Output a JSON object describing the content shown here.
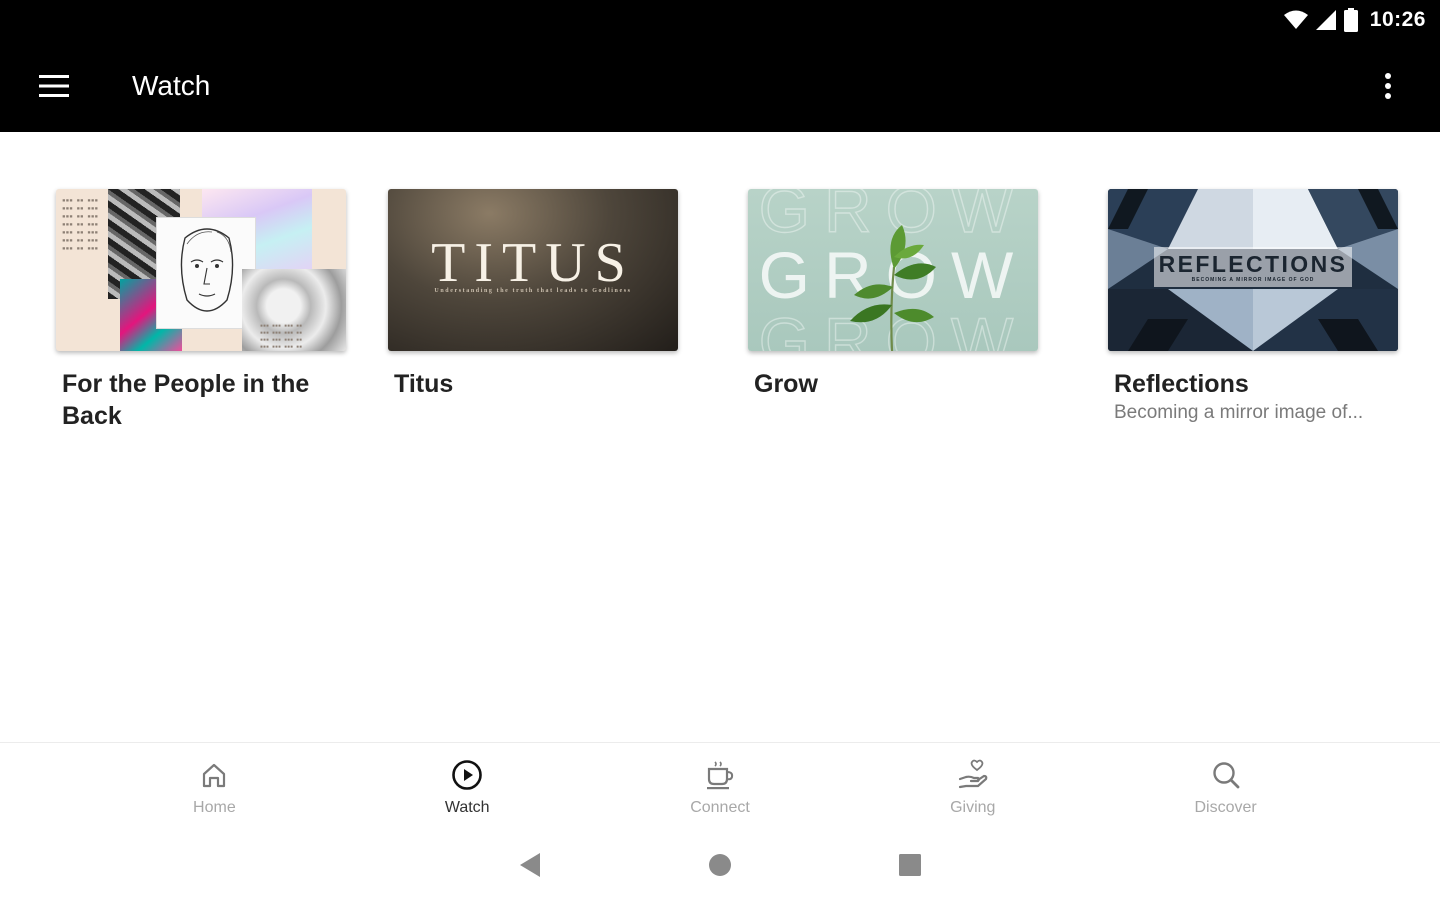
{
  "status_bar": {
    "time": "10:26",
    "icons": [
      "wifi-icon",
      "cellular-signal-icon",
      "battery-icon"
    ]
  },
  "app_bar": {
    "title": "Watch",
    "menu_icon": "hamburger-menu-icon",
    "overflow_icon": "more-vertical-icon"
  },
  "cards": [
    {
      "title": "For the People in the Back",
      "subtitle": ""
    },
    {
      "title": "Titus",
      "subtitle": "",
      "art_text": "TITUS",
      "art_tagline": "Understanding the truth that leads to Godliness"
    },
    {
      "title": "Grow",
      "subtitle": "",
      "art_text": "GROW"
    },
    {
      "title": "Reflections",
      "subtitle": "Becoming a mirror image of...",
      "art_text": "REFLECTIONS",
      "art_tagline": "BECOMING A MIRROR IMAGE OF GOD"
    }
  ],
  "bottom_nav": {
    "items": [
      {
        "label": "Home",
        "icon": "home-icon",
        "active": false
      },
      {
        "label": "Watch",
        "icon": "play-circle-icon",
        "active": true
      },
      {
        "label": "Connect",
        "icon": "coffee-cup-icon",
        "active": false
      },
      {
        "label": "Giving",
        "icon": "giving-hand-icon",
        "active": false
      },
      {
        "label": "Discover",
        "icon": "search-icon",
        "active": false
      }
    ],
    "active_color": "#333333",
    "inactive_color": "#a8a8a8"
  },
  "system_nav": [
    "back-icon",
    "home-circle-icon",
    "recents-square-icon"
  ],
  "colors": {
    "app_bar": "#000000",
    "background": "#ffffff",
    "title_text": "#222222",
    "subtitle_text": "#7a7a7a"
  }
}
